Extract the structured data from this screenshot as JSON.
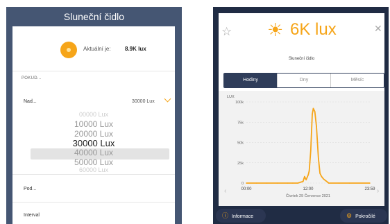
{
  "left": {
    "title": "Sluneční čidlo",
    "current_label": "Aktuální je:",
    "current_value": "8.9K lux",
    "section_label": "POKUD...",
    "row_over_label": "Nad...",
    "row_over_value": "30000 Lux",
    "picker": [
      "10000 Lux",
      "20000 Lux",
      "30000 Lux",
      "40000 Lux",
      "50000 Lux"
    ],
    "picker_dim_top": "00000 Lux",
    "picker_dim_bottom": "60000 Lux",
    "row_under_label": "Pod...",
    "row_interval_label": "Interval"
  },
  "right": {
    "value": "6K lux",
    "name": "Sluneční čidlo",
    "tabs": [
      "Hodiny",
      "Dny",
      "Měsíc"
    ],
    "active_tab": "Hodiny",
    "date_label": "Čtvrtek 29 Července 2021",
    "info_button": "Informace",
    "advanced_button": "Pokročilé",
    "accent": "#f6a519"
  },
  "chart_data": {
    "type": "line",
    "ylabel": "LUX",
    "yticks": [
      "100k",
      "75k",
      "50k",
      "25k",
      "0"
    ],
    "xticks": [
      "00:00",
      "12:00",
      "23:59"
    ],
    "ylim": [
      0,
      100000
    ],
    "x": [
      0,
      2,
      4,
      6,
      8,
      9,
      10,
      10.5,
      11,
      11.3,
      11.6,
      12,
      12.2,
      12.5,
      12.8,
      13,
      13.3,
      13.6,
      14,
      14.3,
      14.6,
      15,
      16,
      18,
      20,
      23.98
    ],
    "series": [
      {
        "values": [
          0,
          0,
          0,
          0,
          0,
          0,
          0,
          1000,
          2000,
          8000,
          4000,
          10000,
          15000,
          40000,
          85000,
          92000,
          88000,
          70000,
          30000,
          12000,
          8000,
          5000,
          0,
          0,
          0,
          0
        ]
      }
    ]
  }
}
